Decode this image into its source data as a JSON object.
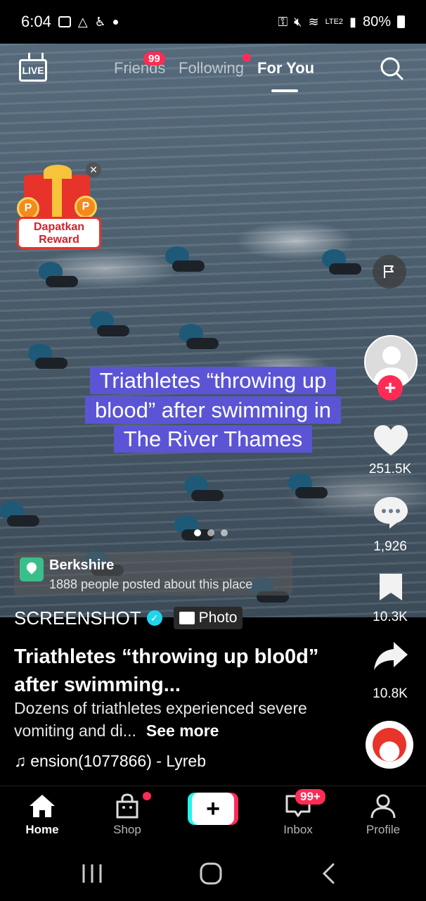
{
  "status_bar": {
    "time": "6:04",
    "network": "LTE2",
    "battery": "80%"
  },
  "top_nav": {
    "live_label": "LIVE",
    "tabs": [
      {
        "label": "Friends",
        "badge": "99"
      },
      {
        "label": "Following"
      },
      {
        "label": "For You",
        "active": true
      }
    ]
  },
  "reward": {
    "label_line1": "Dapatkan",
    "label_line2": "Reward",
    "coin": "P"
  },
  "overlay": {
    "lines": [
      "Triathletes “throwing up",
      "blood” after swimming in",
      "The River Thames"
    ],
    "highlight_color": "#5b55d6"
  },
  "location": {
    "name": "Berkshire",
    "subtitle": "1888 people posted about this place"
  },
  "rail": {
    "likes": "251.5K",
    "comments": "1,926",
    "saves": "10.3K",
    "shares": "10.8K"
  },
  "post": {
    "author": "SCREENSHOT",
    "verified": true,
    "type_label": "Photo",
    "title": "Triathletes “throwing up blo0d” after swimming...",
    "description": "Dozens of triathletes experienced severe vomiting and di...",
    "see_more": "See more",
    "music": "ension(1077866) - Lyreb"
  },
  "tab_bar": {
    "home": "Home",
    "shop": "Shop",
    "inbox": "Inbox",
    "inbox_badge": "99+",
    "profile": "Profile"
  },
  "colors": {
    "accent": "#fe2c55",
    "cyan": "#25f4ee",
    "verified": "#20d5ec"
  }
}
